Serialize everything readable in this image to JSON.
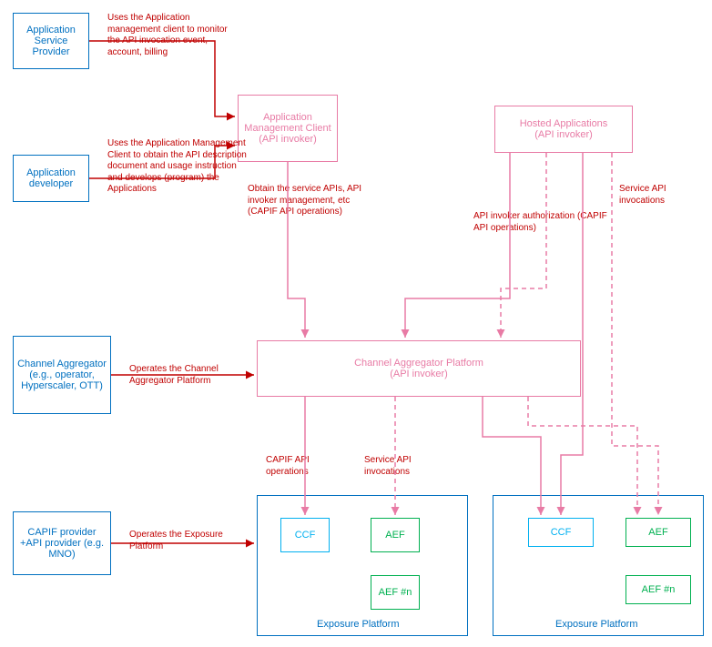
{
  "actors": {
    "asp": "Application Service Provider",
    "adev": "Application developer",
    "ca": "Channel Aggregator (e.g., operator, Hyperscaler, OTT)",
    "capifp": "CAPIF provider +API provider (e.g. MNO)"
  },
  "components": {
    "amc": {
      "title": "Application Management Client",
      "sub": "(API invoker)"
    },
    "hosted": {
      "title": "Hosted Applications",
      "sub": "(API invoker)"
    },
    "cap": {
      "title": "Channel Aggregator Platform",
      "sub": "(API invoker)"
    },
    "ccf": "CCF",
    "aef": "AEF",
    "aefn": "AEF #n"
  },
  "containers": {
    "ep": "Exposure Platform"
  },
  "annotations": {
    "asp_to_amc": "Uses the Application management client to monitor the API invocation event, account, billing",
    "adev_to_amc": "Uses the Application Management Client to obtain the API description document and usage instruction and develops (program) the Applications",
    "ca_to_cap": "Operates the Channel Aggregator Platform",
    "capifp_to_ep": "Operates the Exposure Platform",
    "amc_down": "Obtain the service APIs, API invoker management, etc (CAPIF API operations)",
    "hosted_auth": "API invoker authorization (CAPIF API operations)",
    "hosted_svc": "Service API invocations",
    "cap_capif": "CAPIF API operations",
    "cap_svc": "Service API invocations"
  }
}
